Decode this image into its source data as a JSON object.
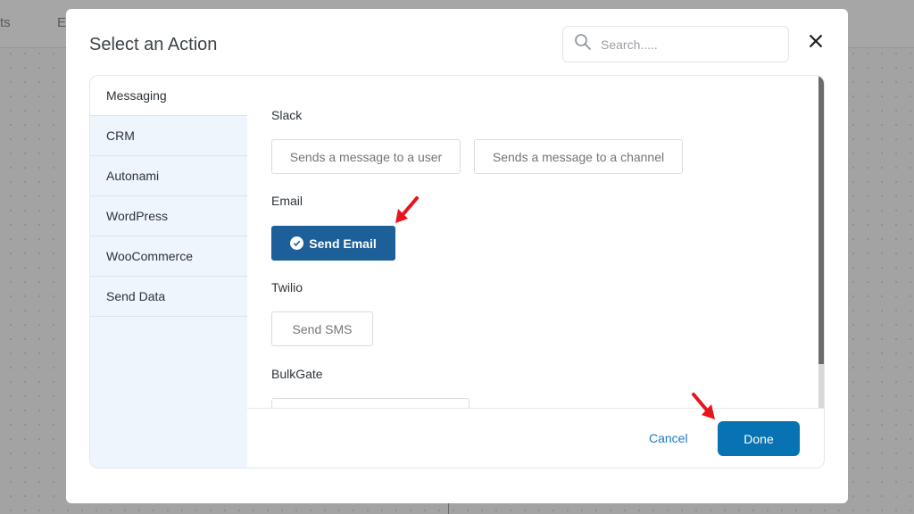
{
  "background": {
    "tabs": [
      "ts",
      "E"
    ]
  },
  "modal": {
    "title": "Select an Action",
    "search": {
      "placeholder": "Search.....",
      "value": ""
    },
    "close_icon": "close-icon"
  },
  "sidebar": {
    "active": "Messaging",
    "items": [
      {
        "label": "Messaging"
      },
      {
        "label": "CRM"
      },
      {
        "label": "Autonami"
      },
      {
        "label": "WordPress"
      },
      {
        "label": "WooCommerce"
      },
      {
        "label": "Send Data"
      }
    ]
  },
  "groups": [
    {
      "label": "Slack",
      "actions": [
        {
          "label": "Sends a message to a user"
        },
        {
          "label": "Sends a message to a channel"
        }
      ]
    },
    {
      "label": "Email",
      "actions": [
        {
          "label": "Send Email",
          "selected": true
        }
      ]
    },
    {
      "label": "Twilio",
      "actions": [
        {
          "label": "Send SMS"
        }
      ]
    },
    {
      "label": "BulkGate",
      "actions": [
        {
          "label": ""
        }
      ]
    }
  ],
  "footer": {
    "cancel_label": "Cancel",
    "done_label": "Done"
  },
  "colors": {
    "primary": "#0873b2",
    "selected_action": "#1d5f99",
    "sidebar_bg": "#eef5fd",
    "annotation_arrow": "#e8141b"
  }
}
